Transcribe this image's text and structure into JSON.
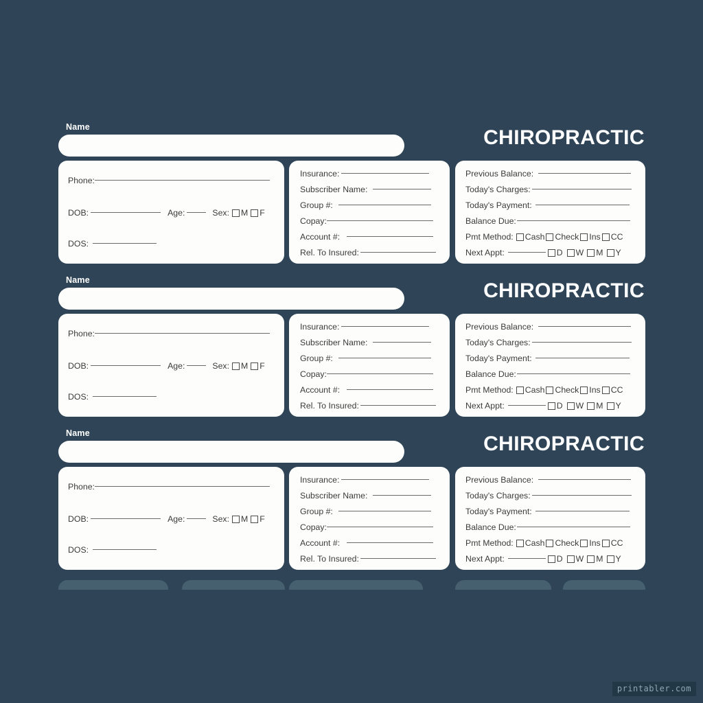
{
  "page": {
    "background_color": "#2f4557",
    "card_color": "#fdfdfc",
    "text_color": "#3b3b3b",
    "brand_text_color": "#ffffff",
    "watermark": "printabler.com"
  },
  "record_template": {
    "name_label": "Name",
    "name_value": "",
    "brand_title": "CHIROPRACTIC",
    "patient_card": {
      "phone_label": "Phone:",
      "dob_label": "DOB:",
      "age_label": "Age:",
      "sex_label": "Sex:",
      "sex_options": [
        "M",
        "F"
      ],
      "dos_label": "DOS:"
    },
    "insurance_card": {
      "rows": [
        "Insurance:",
        "Subscriber Name:",
        "Group #:",
        "Copay:",
        "Account #:",
        "Rel. To Insured:"
      ]
    },
    "billing_card": {
      "rows": [
        "Previous Balance:",
        "Today's Charges:",
        "Today's Payment:",
        "Balance Due:"
      ],
      "pmt_method_label": "Pmt Method:",
      "pmt_method_options": [
        "Cash",
        "Check",
        "Ins",
        "CC"
      ],
      "next_appt_label": "Next Appt:",
      "next_appt_options": [
        "D",
        "W",
        "M",
        "Y"
      ]
    }
  },
  "records": [
    {
      "name_label": "Name",
      "name_value": "",
      "brand_title": "CHIROPRACTIC",
      "patient": {
        "phone_label": "Phone:",
        "dob_label": "DOB:",
        "age_label": "Age:",
        "sex_label": "Sex:",
        "sex_m": "M",
        "sex_f": "F",
        "dos_label": "DOS:"
      },
      "insurance": {
        "r0": "Insurance:",
        "r1": "Subscriber Name:",
        "r2": "Group #:",
        "r3": "Copay:",
        "r4": "Account #:",
        "r5": "Rel. To Insured:"
      },
      "billing": {
        "r0": "Previous Balance:",
        "r1": "Today's Charges:",
        "r2": "Today's Payment:",
        "r3": "Balance Due:",
        "pmt_label": "Pmt Method:",
        "pmt_o0": "Cash",
        "pmt_o1": "Check",
        "pmt_o2": "Ins",
        "pmt_o3": "CC",
        "appt_label": "Next Appt:",
        "appt_o0": "D",
        "appt_o1": "W",
        "appt_o2": "M",
        "appt_o3": "Y"
      }
    },
    {
      "name_label": "Name",
      "name_value": "",
      "brand_title": "CHIROPRACTIC",
      "patient": {
        "phone_label": "Phone:",
        "dob_label": "DOB:",
        "age_label": "Age:",
        "sex_label": "Sex:",
        "sex_m": "M",
        "sex_f": "F",
        "dos_label": "DOS:"
      },
      "insurance": {
        "r0": "Insurance:",
        "r1": "Subscriber Name:",
        "r2": "Group #:",
        "r3": "Copay:",
        "r4": "Account #:",
        "r5": "Rel. To Insured:"
      },
      "billing": {
        "r0": "Previous Balance:",
        "r1": "Today's Charges:",
        "r2": "Today's Payment:",
        "r3": "Balance Due:",
        "pmt_label": "Pmt Method:",
        "pmt_o0": "Cash",
        "pmt_o1": "Check",
        "pmt_o2": "Ins",
        "pmt_o3": "CC",
        "appt_label": "Next Appt:",
        "appt_o0": "D",
        "appt_o1": "W",
        "appt_o2": "M",
        "appt_o3": "Y"
      }
    },
    {
      "name_label": "Name",
      "name_value": "",
      "brand_title": "CHIROPRACTIC",
      "patient": {
        "phone_label": "Phone:",
        "dob_label": "DOB:",
        "age_label": "Age:",
        "sex_label": "Sex:",
        "sex_m": "M",
        "sex_f": "F",
        "dos_label": "DOS:"
      },
      "insurance": {
        "r0": "Insurance:",
        "r1": "Subscriber Name:",
        "r2": "Group #:",
        "r3": "Copay:",
        "r4": "Account #:",
        "r5": "Rel. To Insured:"
      },
      "billing": {
        "r0": "Previous Balance:",
        "r1": "Today's Charges:",
        "r2": "Today's Payment:",
        "r3": "Balance Due:",
        "pmt_label": "Pmt Method:",
        "pmt_o0": "Cash",
        "pmt_o1": "Check",
        "pmt_o2": "Ins",
        "pmt_o3": "CC",
        "appt_label": "Next Appt:",
        "appt_o0": "D",
        "appt_o1": "W",
        "appt_o2": "M",
        "appt_o3": "Y"
      }
    }
  ]
}
